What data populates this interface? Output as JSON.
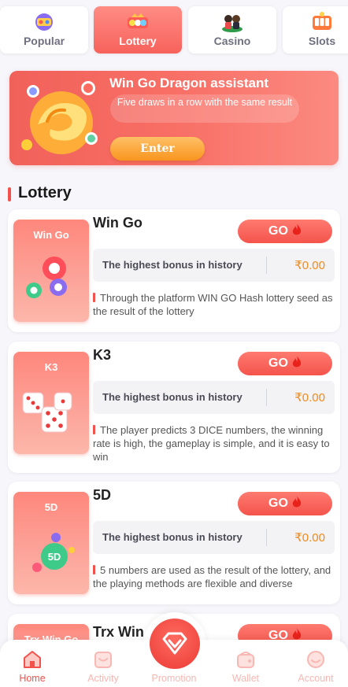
{
  "tabs": [
    {
      "label": "Popular",
      "icon": "popular-icon"
    },
    {
      "label": "Lottery",
      "icon": "lottery-icon",
      "active": true
    },
    {
      "label": "Casino",
      "icon": "casino-icon"
    },
    {
      "label": "Slots",
      "icon": "slots-icon"
    }
  ],
  "banner": {
    "title": "Win Go Dragon assistant",
    "description": "Five draws in a row with the same result",
    "button": "Enter"
  },
  "section": {
    "title": "Lottery"
  },
  "games": [
    {
      "thumb_label": "Win Go",
      "name": "Win Go",
      "go": "GO",
      "bonus_label": "The highest bonus in history",
      "bonus_value": "₹0.00",
      "description": "Through the platform WIN GO Hash lottery seed as the result of the lottery"
    },
    {
      "thumb_label": "K3",
      "name": "K3",
      "go": "GO",
      "bonus_label": "The highest bonus in history",
      "bonus_value": "₹0.00",
      "description": "The player predicts 3 DICE numbers, the winning rate is high, the gameplay is simple, and it is easy to win"
    },
    {
      "thumb_label": "5D",
      "name": "5D",
      "go": "GO",
      "bonus_label": "The highest bonus in history",
      "bonus_value": "₹0.00",
      "description": "5 numbers are used as the result of the lottery, and the playing methods are flexible and diverse"
    },
    {
      "thumb_label": "Trx Win Go",
      "name": "Trx Win",
      "go": "GO"
    }
  ],
  "nav": [
    {
      "label": "Home",
      "icon": "home-icon",
      "active": true
    },
    {
      "label": "Activity",
      "icon": "activity-icon"
    },
    {
      "label": "Promotion",
      "icon": "diamond-icon"
    },
    {
      "label": "Wallet",
      "icon": "wallet-icon"
    },
    {
      "label": "Account",
      "icon": "account-icon"
    }
  ],
  "colors": {
    "accent": "#f2524b",
    "bonus": "#f08a1c",
    "background": "#f6f6fb"
  }
}
